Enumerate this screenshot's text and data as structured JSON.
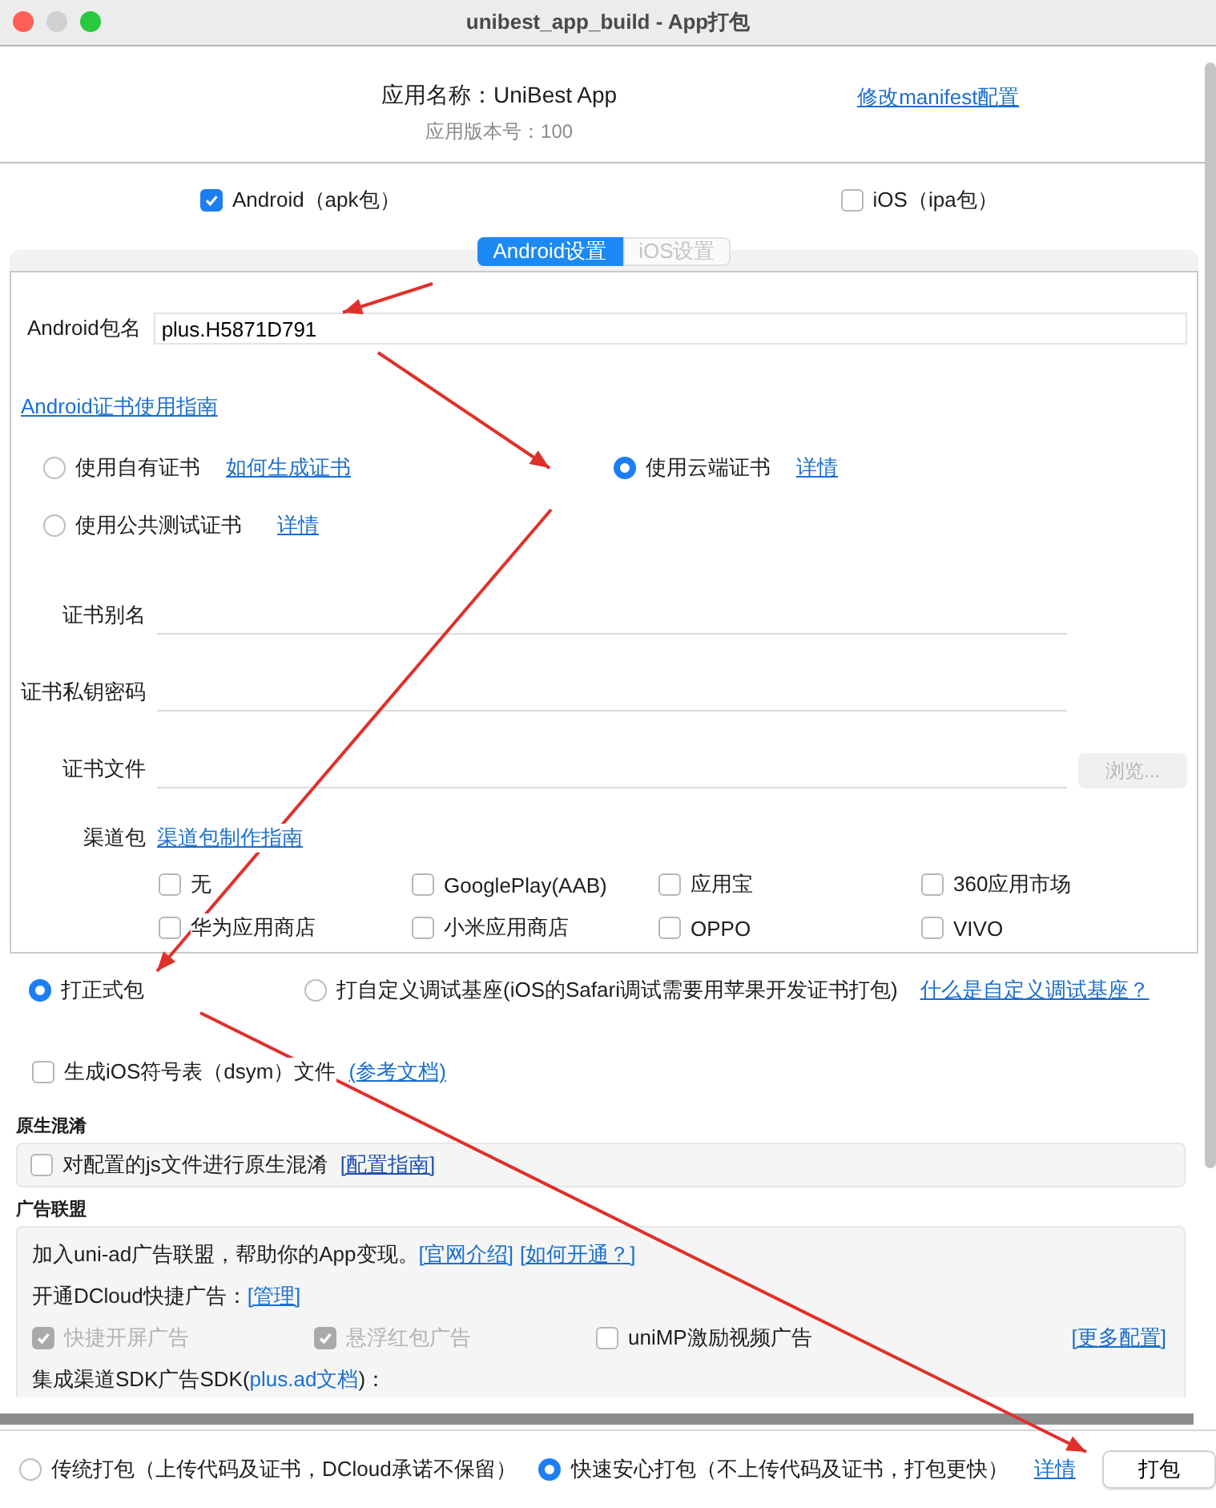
{
  "window": {
    "title": "unibest_app_build - App打包"
  },
  "app": {
    "name": "应用名称：UniBest App",
    "version": "应用版本号：100",
    "manifest_link": "修改manifest配置"
  },
  "platforms": [
    {
      "label": "Android（apk包）",
      "checked": true
    },
    {
      "label": "iOS（ipa包）",
      "checked": false
    }
  ],
  "tabs": [
    {
      "label": "Android设置",
      "selected": true
    },
    {
      "label": "iOS设置",
      "selected": false
    }
  ],
  "android": {
    "package_label": "Android包名",
    "package_value": "plus.H5871D791",
    "guide_link": "Android证书使用指南",
    "cert_options": [
      {
        "label": "使用自有证书",
        "link": "如何生成证书",
        "selected": false
      },
      {
        "label": "使用云端证书",
        "link": "详情",
        "selected": true
      },
      {
        "label": "使用公共测试证书",
        "link": "详情",
        "selected": false
      }
    ],
    "fields": [
      {
        "label": "证书别名",
        "kind": "text"
      },
      {
        "label": "证书私钥密码",
        "kind": "text"
      },
      {
        "label": "证书文件",
        "kind": "file",
        "button": "浏览...",
        "disabled": true
      }
    ],
    "channels": {
      "label": "渠道包",
      "link": "渠道包制作指南",
      "items": [
        {
          "label": "无",
          "checked": false
        },
        {
          "label": "GooglePlay(AAB)",
          "checked": false
        },
        {
          "label": "应用宝",
          "checked": false
        },
        {
          "label": "360应用市场",
          "checked": false
        },
        {
          "label": "华为应用商店",
          "checked": false
        },
        {
          "label": "小米应用商店",
          "checked": false
        },
        {
          "label": "OPPO",
          "checked": false
        },
        {
          "label": "VIVO",
          "checked": false
        }
      ]
    }
  },
  "build_types": [
    {
      "label": "打正式包",
      "selected": true
    },
    {
      "label": "打自定义调试基座(iOS的Safari调试需要用苹果开发证书打包)",
      "selected": false
    }
  ],
  "build_type_help": "什么是自定义调试基座？",
  "dsym": {
    "label": "生成iOS符号表（dsym）文件",
    "link": "(参考文档)",
    "checked": false
  },
  "obfuscation": {
    "title": "原生混淆",
    "label": "对配置的js文件进行原生混淆",
    "link": "[配置指南]",
    "checked": false
  },
  "ads": {
    "title": "广告联盟",
    "intro": "加入uni-ad广告联盟，帮助你的App变现。",
    "intro_links": [
      "[官网介绍]",
      "[如何开通？]"
    ],
    "dcloud_label": "开通DCloud快捷广告：",
    "dcloud_link": "[管理]",
    "options": [
      {
        "label": "快捷开屏广告",
        "checked": true,
        "disabled": true
      },
      {
        "label": "悬浮红包广告",
        "checked": true,
        "disabled": true
      },
      {
        "label": "uniMP激励视频广告",
        "checked": false,
        "disabled": false
      }
    ],
    "more_link": "[更多配置]",
    "sdk_prefix": "集成渠道SDK广告SDK(",
    "sdk_link": "plus.ad文档",
    "sdk_suffix": ")："
  },
  "footer": {
    "modes": [
      {
        "label": "传统打包（上传代码及证书，DCloud承诺不保留）",
        "selected": false
      },
      {
        "label": "快速安心打包（不上传代码及证书，打包更快）",
        "selected": true
      }
    ],
    "details_link": "详情",
    "build_button": "打包"
  }
}
